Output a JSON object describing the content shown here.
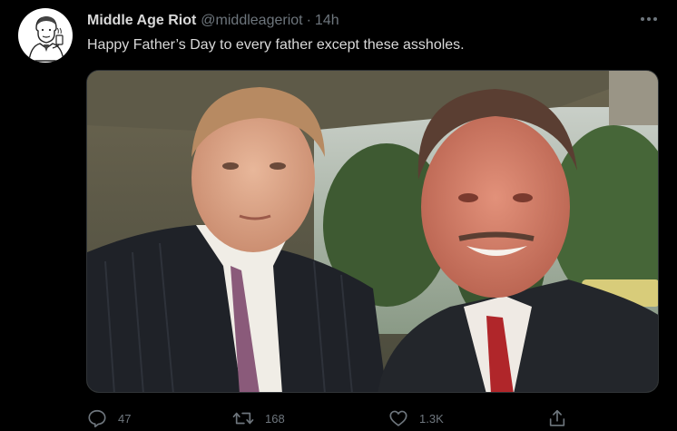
{
  "tweet": {
    "display_name": "Middle Age Riot",
    "handle": "@middleageriot",
    "separator": "·",
    "time": "14h",
    "text": "Happy Father’s Day to every father except these assholes."
  },
  "icons": {
    "avatar": "vintage-man-drinking-illustration",
    "more": "more-horizontal-icon",
    "reply": "reply-icon",
    "retweet": "retweet-icon",
    "like": "heart-icon",
    "share": "share-icon"
  },
  "actions": {
    "reply_count": "47",
    "retweet_count": "168",
    "like_count": "1.3K"
  },
  "colors": {
    "background": "#000000",
    "text": "#d9d9d9",
    "muted": "#6e767d",
    "border": "#2f3336"
  }
}
